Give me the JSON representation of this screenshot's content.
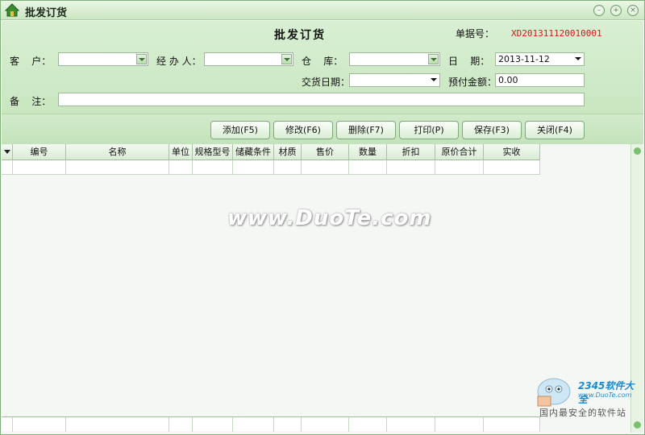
{
  "window": {
    "title": "批发订货"
  },
  "form": {
    "heading": "批发订货",
    "order_no_label": "单据号：",
    "order_no": "XD201311120010001",
    "customer_label": "客    户：",
    "handler_label": "经 办 人：",
    "warehouse_label": "仓    库：",
    "date_label": "日    期：",
    "date_value": "2013-11-12",
    "delivery_date_label": "交货日期：",
    "prepay_label": "预付金额：",
    "prepay_value": "0.00",
    "remark_label": "备    注："
  },
  "toolbar": {
    "add": "添加(F5)",
    "edit": "修改(F6)",
    "delete": "删除(F7)",
    "print": "打印(P)",
    "save": "保存(F3)",
    "close": "关闭(F4)"
  },
  "grid": {
    "columns": [
      "编号",
      "名称",
      "单位",
      "规格型号",
      "储藏条件",
      "材质",
      "售价",
      "数量",
      "折扣",
      "原价合计",
      "实收"
    ]
  },
  "watermark": "www.DuoTe.com",
  "logo": {
    "brand": "2345软件大全",
    "url": "www.DuoTe.com",
    "slogan": "国内最安全的软件站"
  },
  "colors": {
    "accent_green": "#c8e6c0",
    "order_no_red": "#d21818"
  }
}
